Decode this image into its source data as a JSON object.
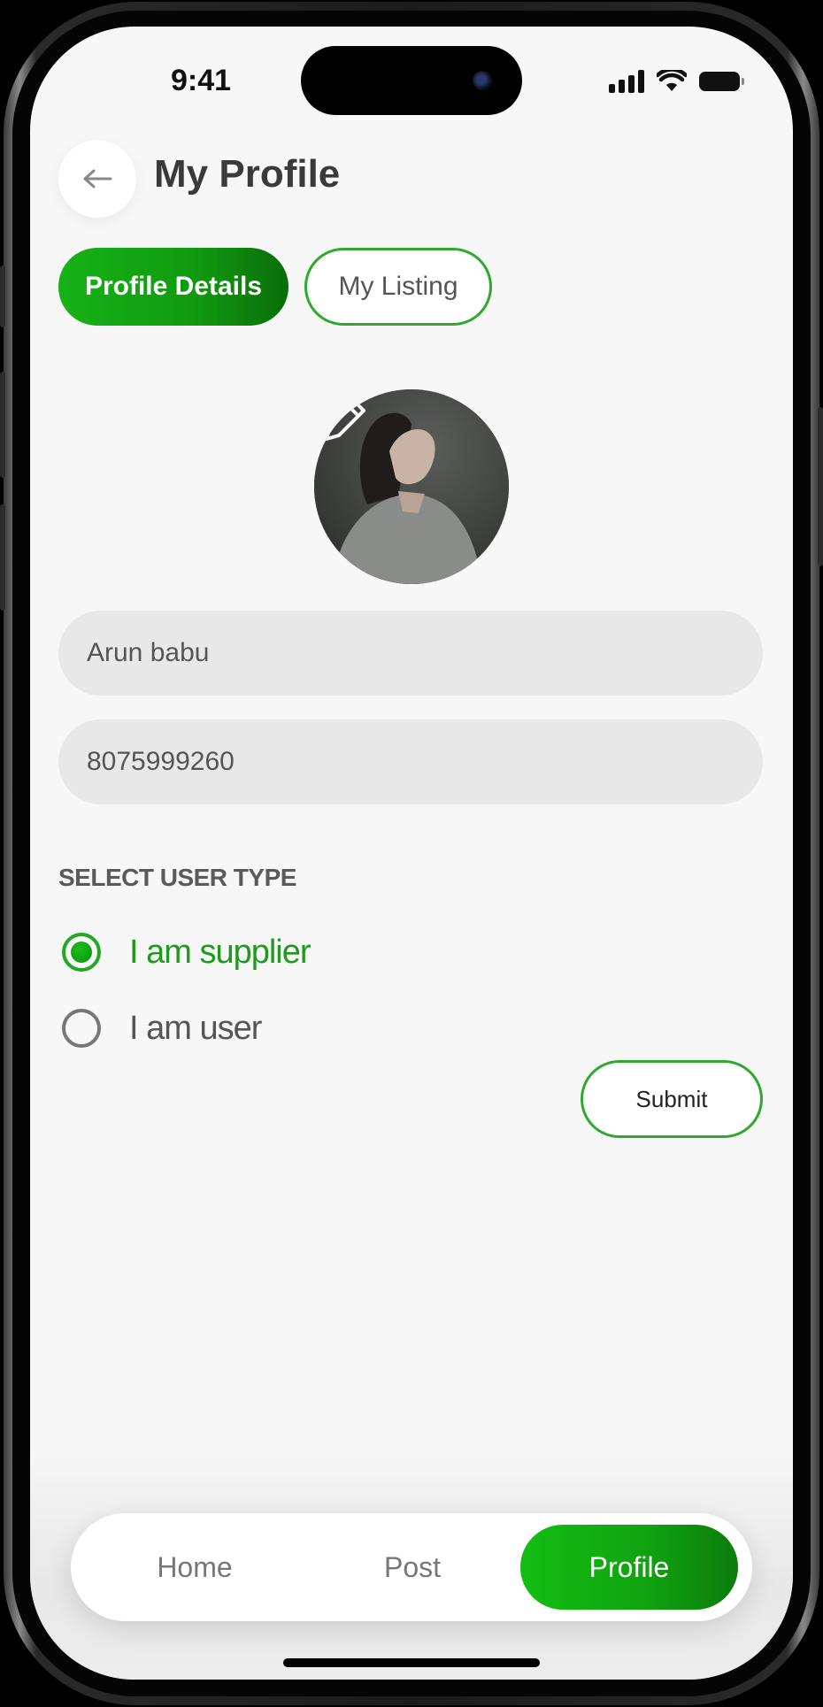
{
  "status_bar": {
    "time": "9:41"
  },
  "header": {
    "title": "My Profile"
  },
  "tabs": {
    "active": "Profile Details",
    "inactive": "My Listing"
  },
  "form": {
    "name_value": "Arun babu",
    "phone_value": "8075999260",
    "user_type_label": "SELECT USER TYPE",
    "options": [
      {
        "label": "I am supplier",
        "selected": true
      },
      {
        "label": "I am user",
        "selected": false
      }
    ],
    "submit_label": "Submit"
  },
  "nav": {
    "home": "Home",
    "post": "Post",
    "profile": "Profile",
    "active": "Profile"
  },
  "colors": {
    "accent": "#16b316",
    "accent_dark": "#0a6d0a",
    "field_bg": "#e8e8e8",
    "screen_bg": "#f7f7f7"
  }
}
